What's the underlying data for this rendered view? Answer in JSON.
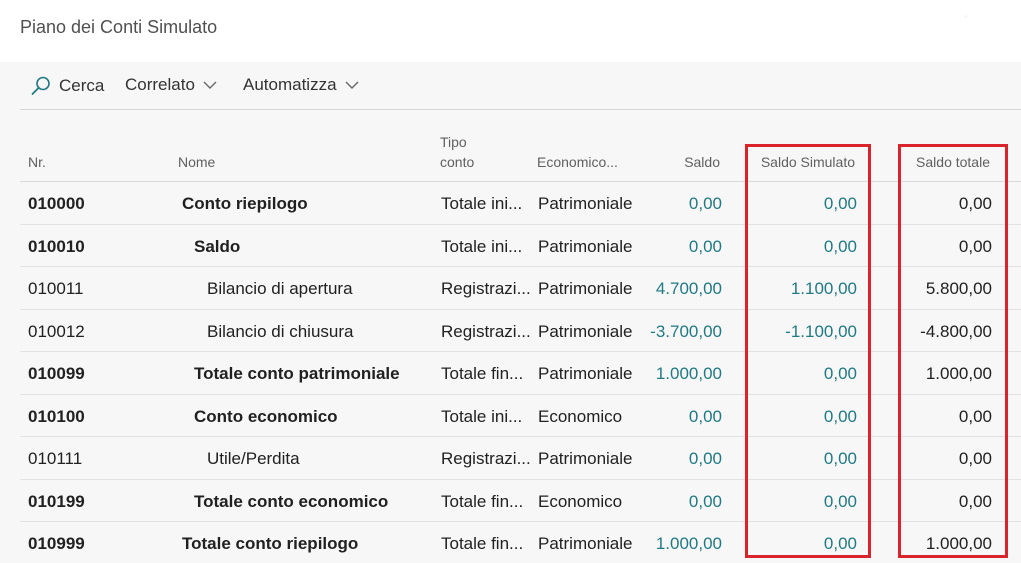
{
  "page": {
    "title": "Piano dei Conti Simulato"
  },
  "toolbar": {
    "search_label": "Cerca",
    "related_label": "Correlato",
    "automate_label": "Automatizza"
  },
  "columns": {
    "nr": "Nr.",
    "name": "Nome",
    "type_line1": "Tipo",
    "type_line2": "conto",
    "economic": "Economico...",
    "balance": "Saldo",
    "sim_balance": "Saldo Simulato",
    "total_balance": "Saldo totale"
  },
  "rows": [
    {
      "nr": "010000",
      "name": "Conto riepilogo",
      "indent": 0,
      "bold": true,
      "type": "Totale ini...",
      "economic": "Patrimoniale",
      "balance": "0,00",
      "sim": "0,00",
      "total": "0,00"
    },
    {
      "nr": "010010",
      "name": "Saldo",
      "indent": 1,
      "bold": true,
      "type": "Totale ini...",
      "economic": "Patrimoniale",
      "balance": "0,00",
      "sim": "0,00",
      "total": "0,00"
    },
    {
      "nr": "010011",
      "name": "Bilancio di apertura",
      "indent": 2,
      "bold": false,
      "type": "Registrazi...",
      "economic": "Patrimoniale",
      "balance": "4.700,00",
      "sim": "1.100,00",
      "total": "5.800,00"
    },
    {
      "nr": "010012",
      "name": "Bilancio di chiusura",
      "indent": 2,
      "bold": false,
      "type": "Registrazi...",
      "economic": "Patrimoniale",
      "balance": "-3.700,00",
      "sim": "-1.100,00",
      "total": "-4.800,00"
    },
    {
      "nr": "010099",
      "name": "Totale conto patrimoniale",
      "indent": 1,
      "bold": true,
      "type": "Totale fin...",
      "economic": "Patrimoniale",
      "balance": "1.000,00",
      "sim": "0,00",
      "total": "1.000,00"
    },
    {
      "nr": "010100",
      "name": "Conto economico",
      "indent": 1,
      "bold": true,
      "type": "Totale ini...",
      "economic": "Economico",
      "balance": "0,00",
      "sim": "0,00",
      "total": "0,00"
    },
    {
      "nr": "010111",
      "name": "Utile/Perdita",
      "indent": 2,
      "bold": false,
      "type": "Registrazi...",
      "economic": "Patrimoniale",
      "balance": "0,00",
      "sim": "0,00",
      "total": "0,00"
    },
    {
      "nr": "010199",
      "name": "Totale conto economico",
      "indent": 1,
      "bold": true,
      "type": "Totale fin...",
      "economic": "Economico",
      "balance": "0,00",
      "sim": "0,00",
      "total": "0,00"
    },
    {
      "nr": "010999",
      "name": "Totale conto riepilogo",
      "indent": 0,
      "bold": true,
      "type": "Totale fin...",
      "economic": "Patrimoniale",
      "balance": "1.000,00",
      "sim": "0,00",
      "total": "1.000,00"
    }
  ],
  "colors": {
    "accent_teal": "#1f7a84",
    "highlight_red": "#d9242c"
  },
  "icons": {
    "search": "search-icon",
    "chevron": "chevron-down-icon"
  }
}
